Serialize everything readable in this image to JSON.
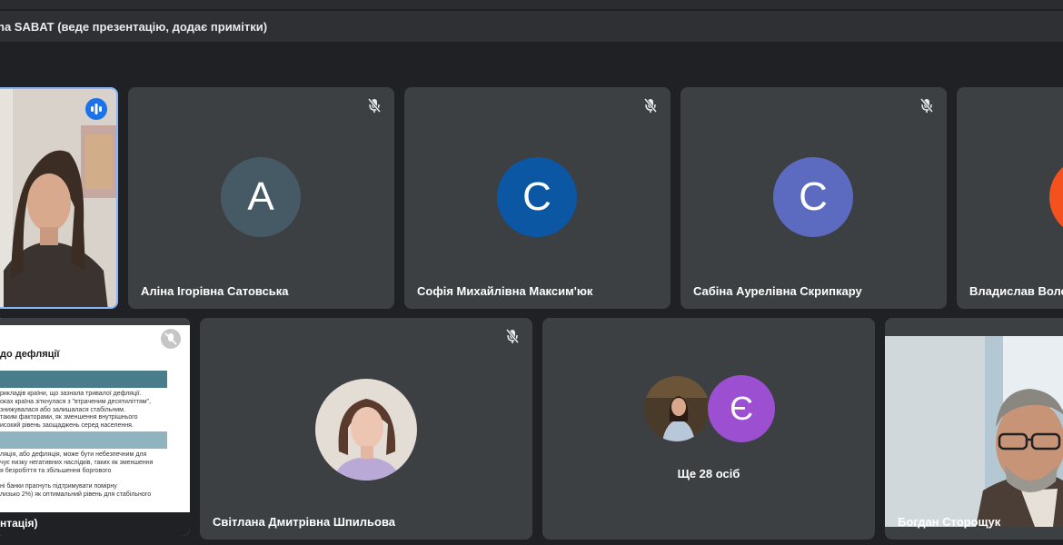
{
  "banner": {
    "text": "na SABAT (веде презентацію, додає примітки)"
  },
  "participants": [
    {
      "name": "Аліна Ігорівна Сатовська",
      "initial": "А",
      "color": "#455a64"
    },
    {
      "name": "Софія Михайлівна Максим'юк",
      "initial": "С",
      "color": "#0b57a4"
    },
    {
      "name": "Сабіна Аурелівна Скрипкару",
      "initial": "С",
      "color": "#5c6bc0"
    },
    {
      "name": "Владислав Володимирович",
      "initial": "",
      "color": "#f4511e"
    },
    {
      "name": "Світлана Дмитрівна Шпильова"
    },
    {
      "name": "Богдан Сторощук"
    }
  ],
  "more_tile": {
    "label": "Ще 28 осіб",
    "avatar_initial": "Є",
    "avatar_color": "#9c4fd1"
  },
  "presentation": {
    "title": "до дефляції",
    "lines": [
      "рикладів країни, що зазнала тривалої дефляції.",
      "оках країна зіткнулася з \"втраченим десятиліттям\",",
      "знижувалася або залишалася стабільним.",
      "таким факторами, як зменшення внутрішнього",
      "исокий рівень заощаджень серед населення.",
      "ляція, або дефляція, може бути небезпечним для",
      "чує низку негативних наслідків, таких як зменшення",
      "я безробіття та збільшення боргового",
      "ні банки прагнуть підтримувати помірну",
      "лизько 2%) як оптимальний рівень для стабільного"
    ],
    "footer": "нтація)"
  },
  "colors": {
    "background": "#202124",
    "tile": "#3c4043",
    "speaking": "#1a73e8"
  }
}
